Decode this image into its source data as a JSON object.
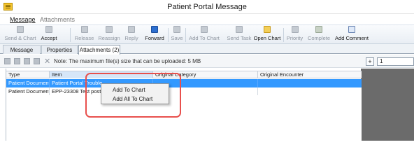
{
  "window": {
    "title": "Patient Portal Message"
  },
  "menu": {
    "items": [
      "Message",
      "Attachments"
    ]
  },
  "toolbar": {
    "buttons": [
      {
        "label": "Send & Chart"
      },
      {
        "label": "Accept"
      },
      {
        "label": "Release"
      },
      {
        "label": "Reassign"
      },
      {
        "label": "Reply"
      },
      {
        "label": "Forward"
      },
      {
        "label": "Save"
      },
      {
        "label": "Add To Chart"
      },
      {
        "label": "Send Task"
      },
      {
        "label": "Open Chart"
      },
      {
        "label": "Priority"
      },
      {
        "label": "Complete"
      },
      {
        "label": "Add Comment"
      }
    ]
  },
  "tabs": {
    "items": [
      "Message",
      "Properties",
      "Attachments (2)"
    ],
    "selected": 2
  },
  "note": {
    "text": "Note: The maximum file(s) size that can be uploaded: 5 MB"
  },
  "pager": {
    "plus": "+",
    "value": "1"
  },
  "grid": {
    "columns": [
      "Type",
      "Item",
      "Original Category",
      "Original Encounter"
    ],
    "rows": [
      {
        "type": "Patient Document",
        "item": "Patient Portal Trouble",
        "category": "",
        "encounter": ""
      },
      {
        "type": "Patient Document",
        "item": "EPP-23308 Test post",
        "category": "",
        "encounter": ""
      }
    ]
  },
  "context_menu": {
    "items": [
      "Add To Chart",
      "Add All To Chart"
    ]
  },
  "colors": {
    "selection": "#3399ff",
    "highlight_ring": "#e8504d",
    "accent_blue": "#2d6fd0"
  }
}
